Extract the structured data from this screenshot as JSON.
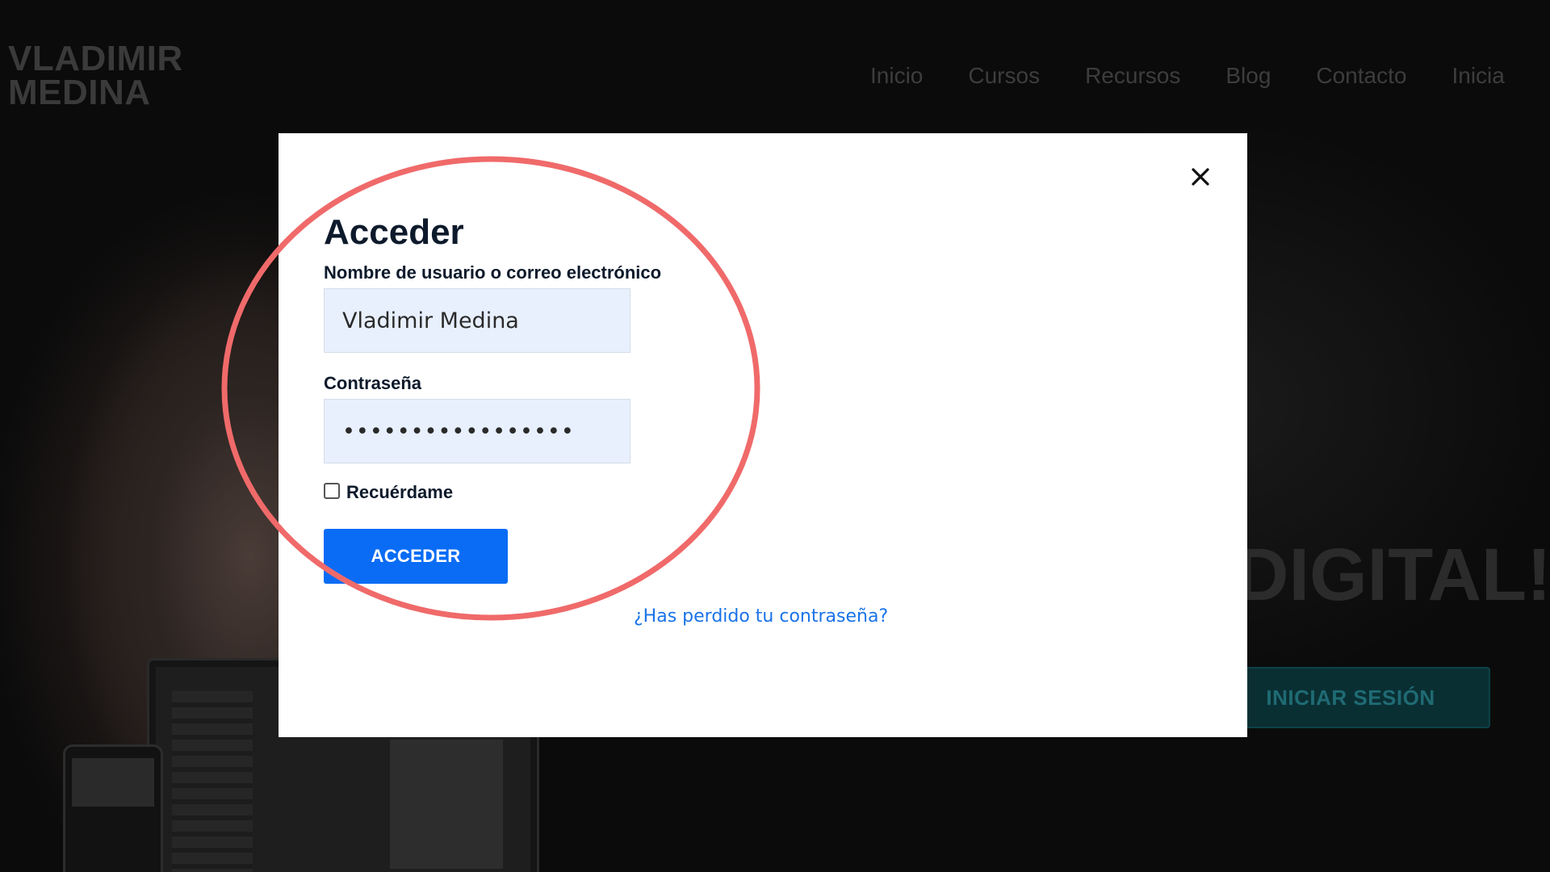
{
  "site": {
    "logo_line1": "VLADIMIR",
    "logo_line2": "MEDINA",
    "nav": [
      "Inicio",
      "Cursos",
      "Recursos",
      "Blog",
      "Contacto",
      "Inicia"
    ],
    "hero_text": "DIGITAL!",
    "hero_button": "INICIAR SESIÓN"
  },
  "login_modal": {
    "title": "Acceder",
    "username_label": "Nombre de usuario o correo electrónico",
    "username_value": "Vladimir Medina",
    "password_label": "Contraseña",
    "password_value": "•••••••••••••••••",
    "remember_label": "Recuérdame",
    "remember_checked": false,
    "submit_label": "ACCEDER",
    "lost_password_link": "¿Has perdido tu contraseña?"
  },
  "icons": {
    "close": "close-icon"
  },
  "colors": {
    "primary_button": "#0a6cf5",
    "input_background": "#e8f0fe",
    "link": "#1a73e8",
    "annotation_circle": "#f06a6a"
  }
}
